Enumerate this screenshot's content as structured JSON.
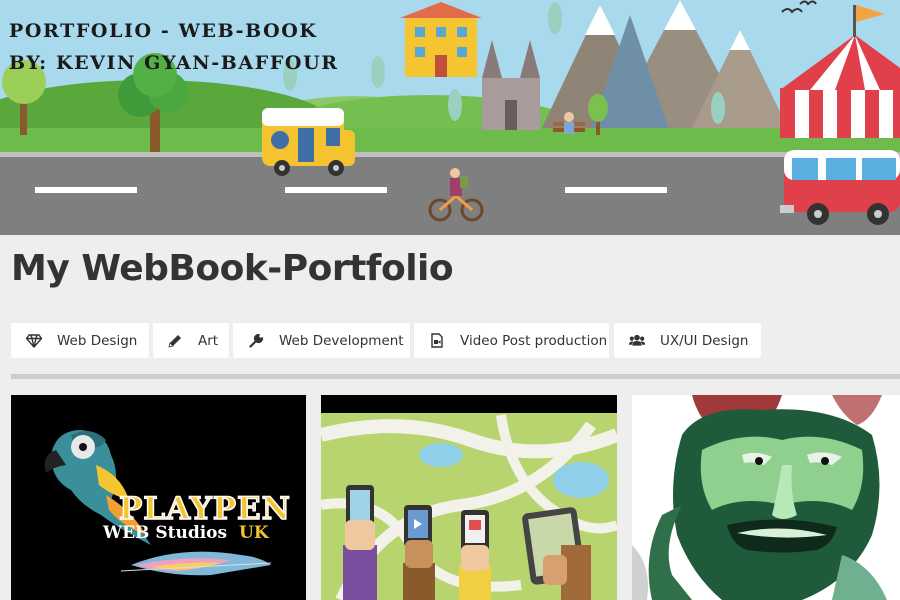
{
  "banner": {
    "title_line1": "PORTFOLIO - WEB-BOOK",
    "title_line2": "BY: KEVIN GYAN-BAFFOUR"
  },
  "page_title": "My WebBook-Portfolio",
  "filters": [
    {
      "label": "Web Design",
      "icon": "diamond-icon"
    },
    {
      "label": "Art",
      "icon": "pencil-icon"
    },
    {
      "label": "Web Development",
      "icon": "wrench-icon"
    },
    {
      "label": "Video Post production",
      "icon": "file-video-icon"
    },
    {
      "label": "UX/UI Design",
      "icon": "users-icon"
    }
  ],
  "gallery": {
    "card1": {
      "line1": "PLAYPEN",
      "line2": "WEB Studios",
      "line2_accent": "UK"
    }
  },
  "colors": {
    "sky": "#a9d9ec",
    "grass": "#6dbb4a",
    "road": "#7f7f7f",
    "page_bg": "#eeeeee",
    "text": "#333333",
    "accent_yellow": "#f4c531",
    "accent_red": "#e0404a"
  }
}
